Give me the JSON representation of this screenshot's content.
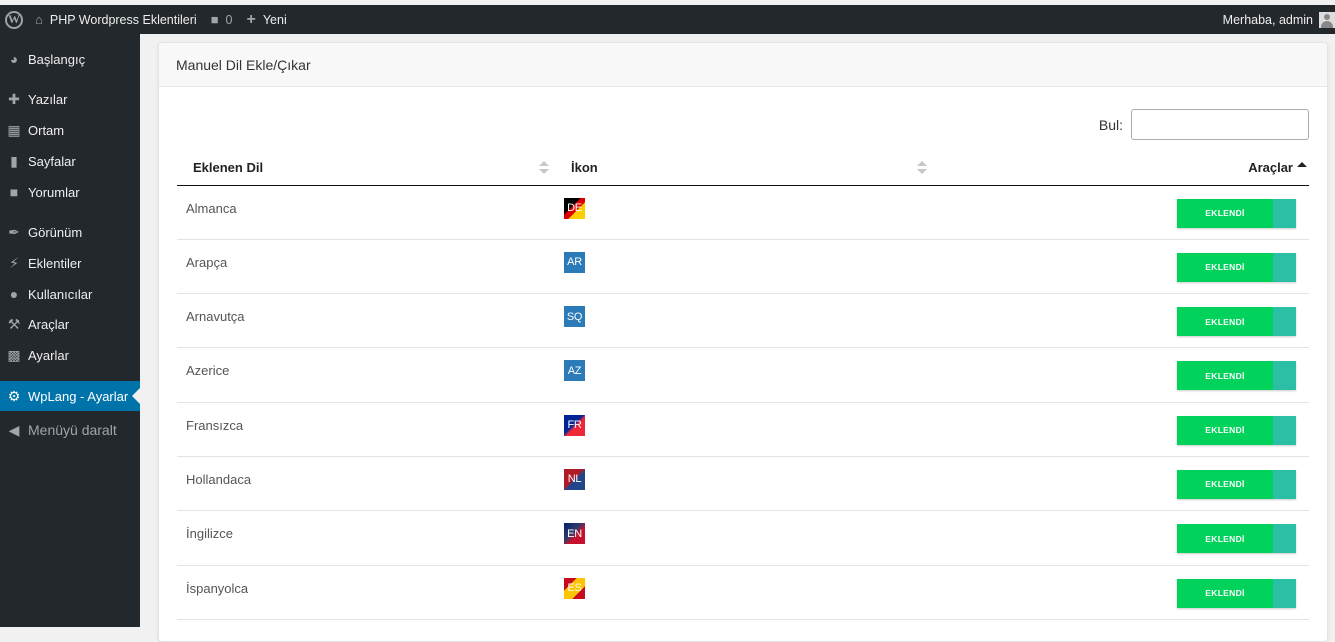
{
  "adminbar": {
    "site_name": "PHP Wordpress Eklentileri",
    "comments_count": "0",
    "new_label": "Yeni",
    "greeting": "Merhaba, admin"
  },
  "sidebar": {
    "items": [
      {
        "label": "Başlangıç",
        "icon": "dashboard-icon"
      },
      {
        "label": "Yazılar",
        "icon": "pin-icon"
      },
      {
        "label": "Ortam",
        "icon": "media-icon"
      },
      {
        "label": "Sayfalar",
        "icon": "pages-icon"
      },
      {
        "label": "Yorumlar",
        "icon": "comment-icon"
      },
      {
        "label": "Görünüm",
        "icon": "brush-icon"
      },
      {
        "label": "Eklentiler",
        "icon": "plugin-icon"
      },
      {
        "label": "Kullanıcılar",
        "icon": "user-icon"
      },
      {
        "label": "Araçlar",
        "icon": "wrench-icon"
      },
      {
        "label": "Ayarlar",
        "icon": "settings-icon"
      },
      {
        "label": "WpLang - Ayarlar",
        "icon": "gear-icon"
      },
      {
        "label": "Menüyü daralt",
        "icon": "collapse-icon"
      }
    ]
  },
  "card": {
    "title": "Manuel Dil Ekle/Çıkar",
    "search_label": "Bul:",
    "search_value": "",
    "columns": [
      "Eklenen Dil",
      "İkon",
      "Araçlar"
    ],
    "rows": [
      {
        "language": "Almanca",
        "code": "DE",
        "status": "EKLENDİ"
      },
      {
        "language": "Arapça",
        "code": "AR",
        "status": "EKLENDİ"
      },
      {
        "language": "Arnavutça",
        "code": "SQ",
        "status": "EKLENDİ"
      },
      {
        "language": "Azerice",
        "code": "AZ",
        "status": "EKLENDİ"
      },
      {
        "language": "Fransızca",
        "code": "FR",
        "status": "EKLENDİ"
      },
      {
        "language": "Hollandaca",
        "code": "NL",
        "status": "EKLENDİ"
      },
      {
        "language": "İngilizce",
        "code": "EN",
        "status": "EKLENDİ"
      },
      {
        "language": "İspanyolca",
        "code": "ES",
        "status": "EKLENDİ"
      }
    ]
  },
  "colors": {
    "adminbar_bg": "#23282d",
    "active_menu": "#0073aa",
    "toggle_on": "#00d25b",
    "toggle_handle": "#2bbfa6"
  }
}
